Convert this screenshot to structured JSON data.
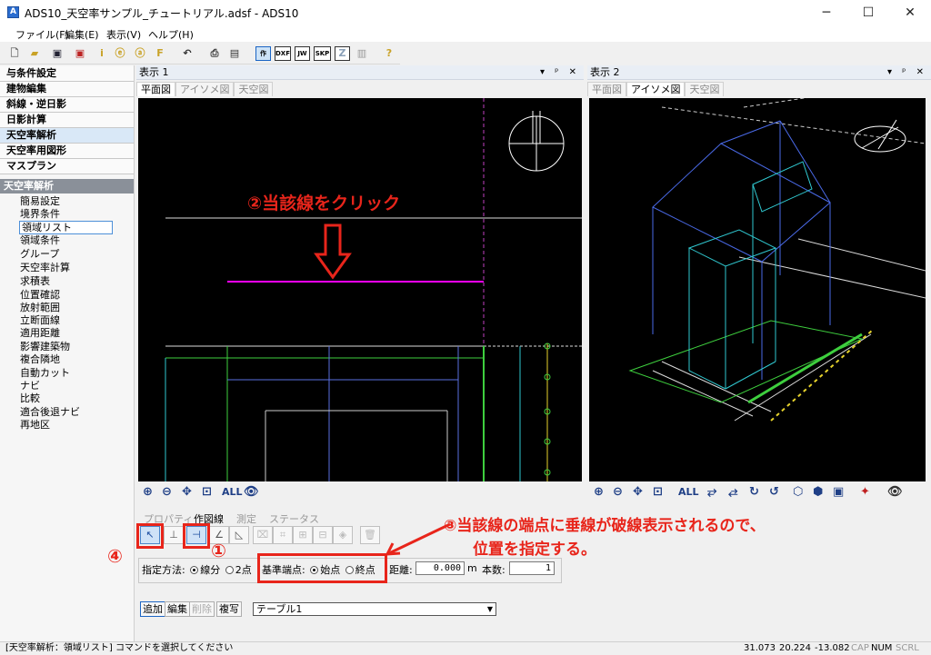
{
  "window": {
    "title": "ADS10_天空率サンプル_チュートリアル.adsf - ADS10",
    "app_icon": "A",
    "minimize": "─",
    "maximize": "☐",
    "close": "✕"
  },
  "menu": [
    "ファイル(F)",
    "編集(E)",
    "表示(V)",
    "ヘルプ(H)"
  ],
  "toolbar": {
    "labels": [
      "作",
      "DXF",
      "JW",
      "SKP",
      "Z"
    ]
  },
  "sidebar": {
    "categories": [
      "与条件設定",
      "建物編集",
      "斜線・逆日影",
      "日影計算",
      "天空率解析",
      "天空率用図形",
      "マスプラン"
    ],
    "selected_category": "天空率解析",
    "sub_header": "天空率解析",
    "items": [
      "簡易設定",
      "境界条件",
      "領域リスト",
      "領域条件",
      "グループ",
      "天空率計算",
      "求積表",
      "位置確認",
      "放射範囲",
      "立断面線",
      "適用距離",
      "影響建築物",
      "複合隣地",
      "自動カット",
      "ナビ",
      "比較",
      "適合後退ナビ",
      "再地区"
    ],
    "selected_item": "領域リスト"
  },
  "view1": {
    "title": "表示 1",
    "controls": "▾ ᵖ ✕",
    "tabs": [
      "平面図",
      "アイソメ図",
      "天空図"
    ],
    "active_tab": "平面図",
    "all_label": "ALL"
  },
  "view2": {
    "title": "表示 2",
    "controls": "▾ ᵖ ✕",
    "tabs": [
      "平面図",
      "アイソメ図",
      "天空図"
    ],
    "active_tab": "アイソメ図",
    "all_label": "ALL"
  },
  "bottom": {
    "tabs": [
      "プロパティ",
      "作図線",
      "測定",
      "ステータス"
    ],
    "active_tab": "作図線",
    "method_label": "指定方法:",
    "method_options": [
      "線分",
      "2点"
    ],
    "base_label": "基準端点:",
    "base_options": [
      "始点",
      "終点"
    ],
    "distance_label": "距離:",
    "distance_value": "0.000",
    "distance_unit": "m",
    "count_label": "本数:",
    "count_value": "1",
    "buttons": [
      "追加",
      "編集",
      "削除",
      "複写"
    ],
    "table_value": "テーブル1"
  },
  "status": {
    "message": "[天空率解析：領域リスト] コマンドを選択してください",
    "x": "31.073",
    "y": "20.224",
    "z": "-13.082",
    "indicators": [
      "CAP",
      "NUM",
      "SCRL"
    ]
  },
  "annotations": {
    "step1": "①",
    "step2": "②当該線をクリック",
    "step3_line1": "③当該線の端点に垂線が破線表示されるので、",
    "step3_line2": "位置を指定する。",
    "step4": "④"
  },
  "colors": {
    "annotation_red": "#e8251b",
    "canvas_bg": "#000000",
    "selected_line": "#ff00ff",
    "accent_blue": "#1c65c4"
  }
}
